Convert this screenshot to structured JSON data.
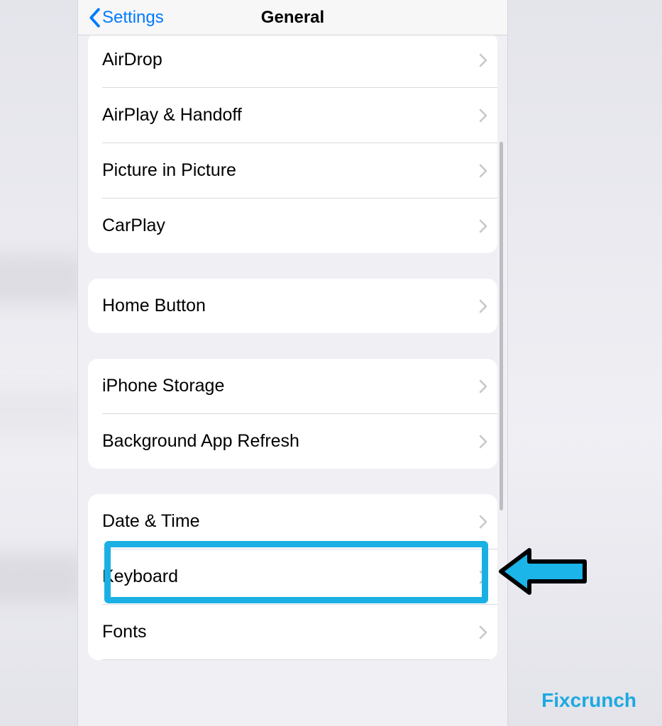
{
  "nav": {
    "back_label": "Settings",
    "title": "General"
  },
  "groups": [
    {
      "rows": [
        {
          "label": "AirDrop"
        },
        {
          "label": "AirPlay & Handoff"
        },
        {
          "label": "Picture in Picture"
        },
        {
          "label": "CarPlay"
        }
      ]
    },
    {
      "rows": [
        {
          "label": "Home Button"
        }
      ]
    },
    {
      "rows": [
        {
          "label": "iPhone Storage"
        },
        {
          "label": "Background App Refresh"
        }
      ]
    },
    {
      "rows": [
        {
          "label": "Date & Time",
          "highlighted": true
        },
        {
          "label": "Keyboard"
        },
        {
          "label": "Fonts"
        }
      ]
    }
  ],
  "watermark": {
    "bold": "Fix",
    "rest": "crunch"
  },
  "colors": {
    "ios_blue": "#007aff",
    "highlight": "#1bb0e4"
  }
}
